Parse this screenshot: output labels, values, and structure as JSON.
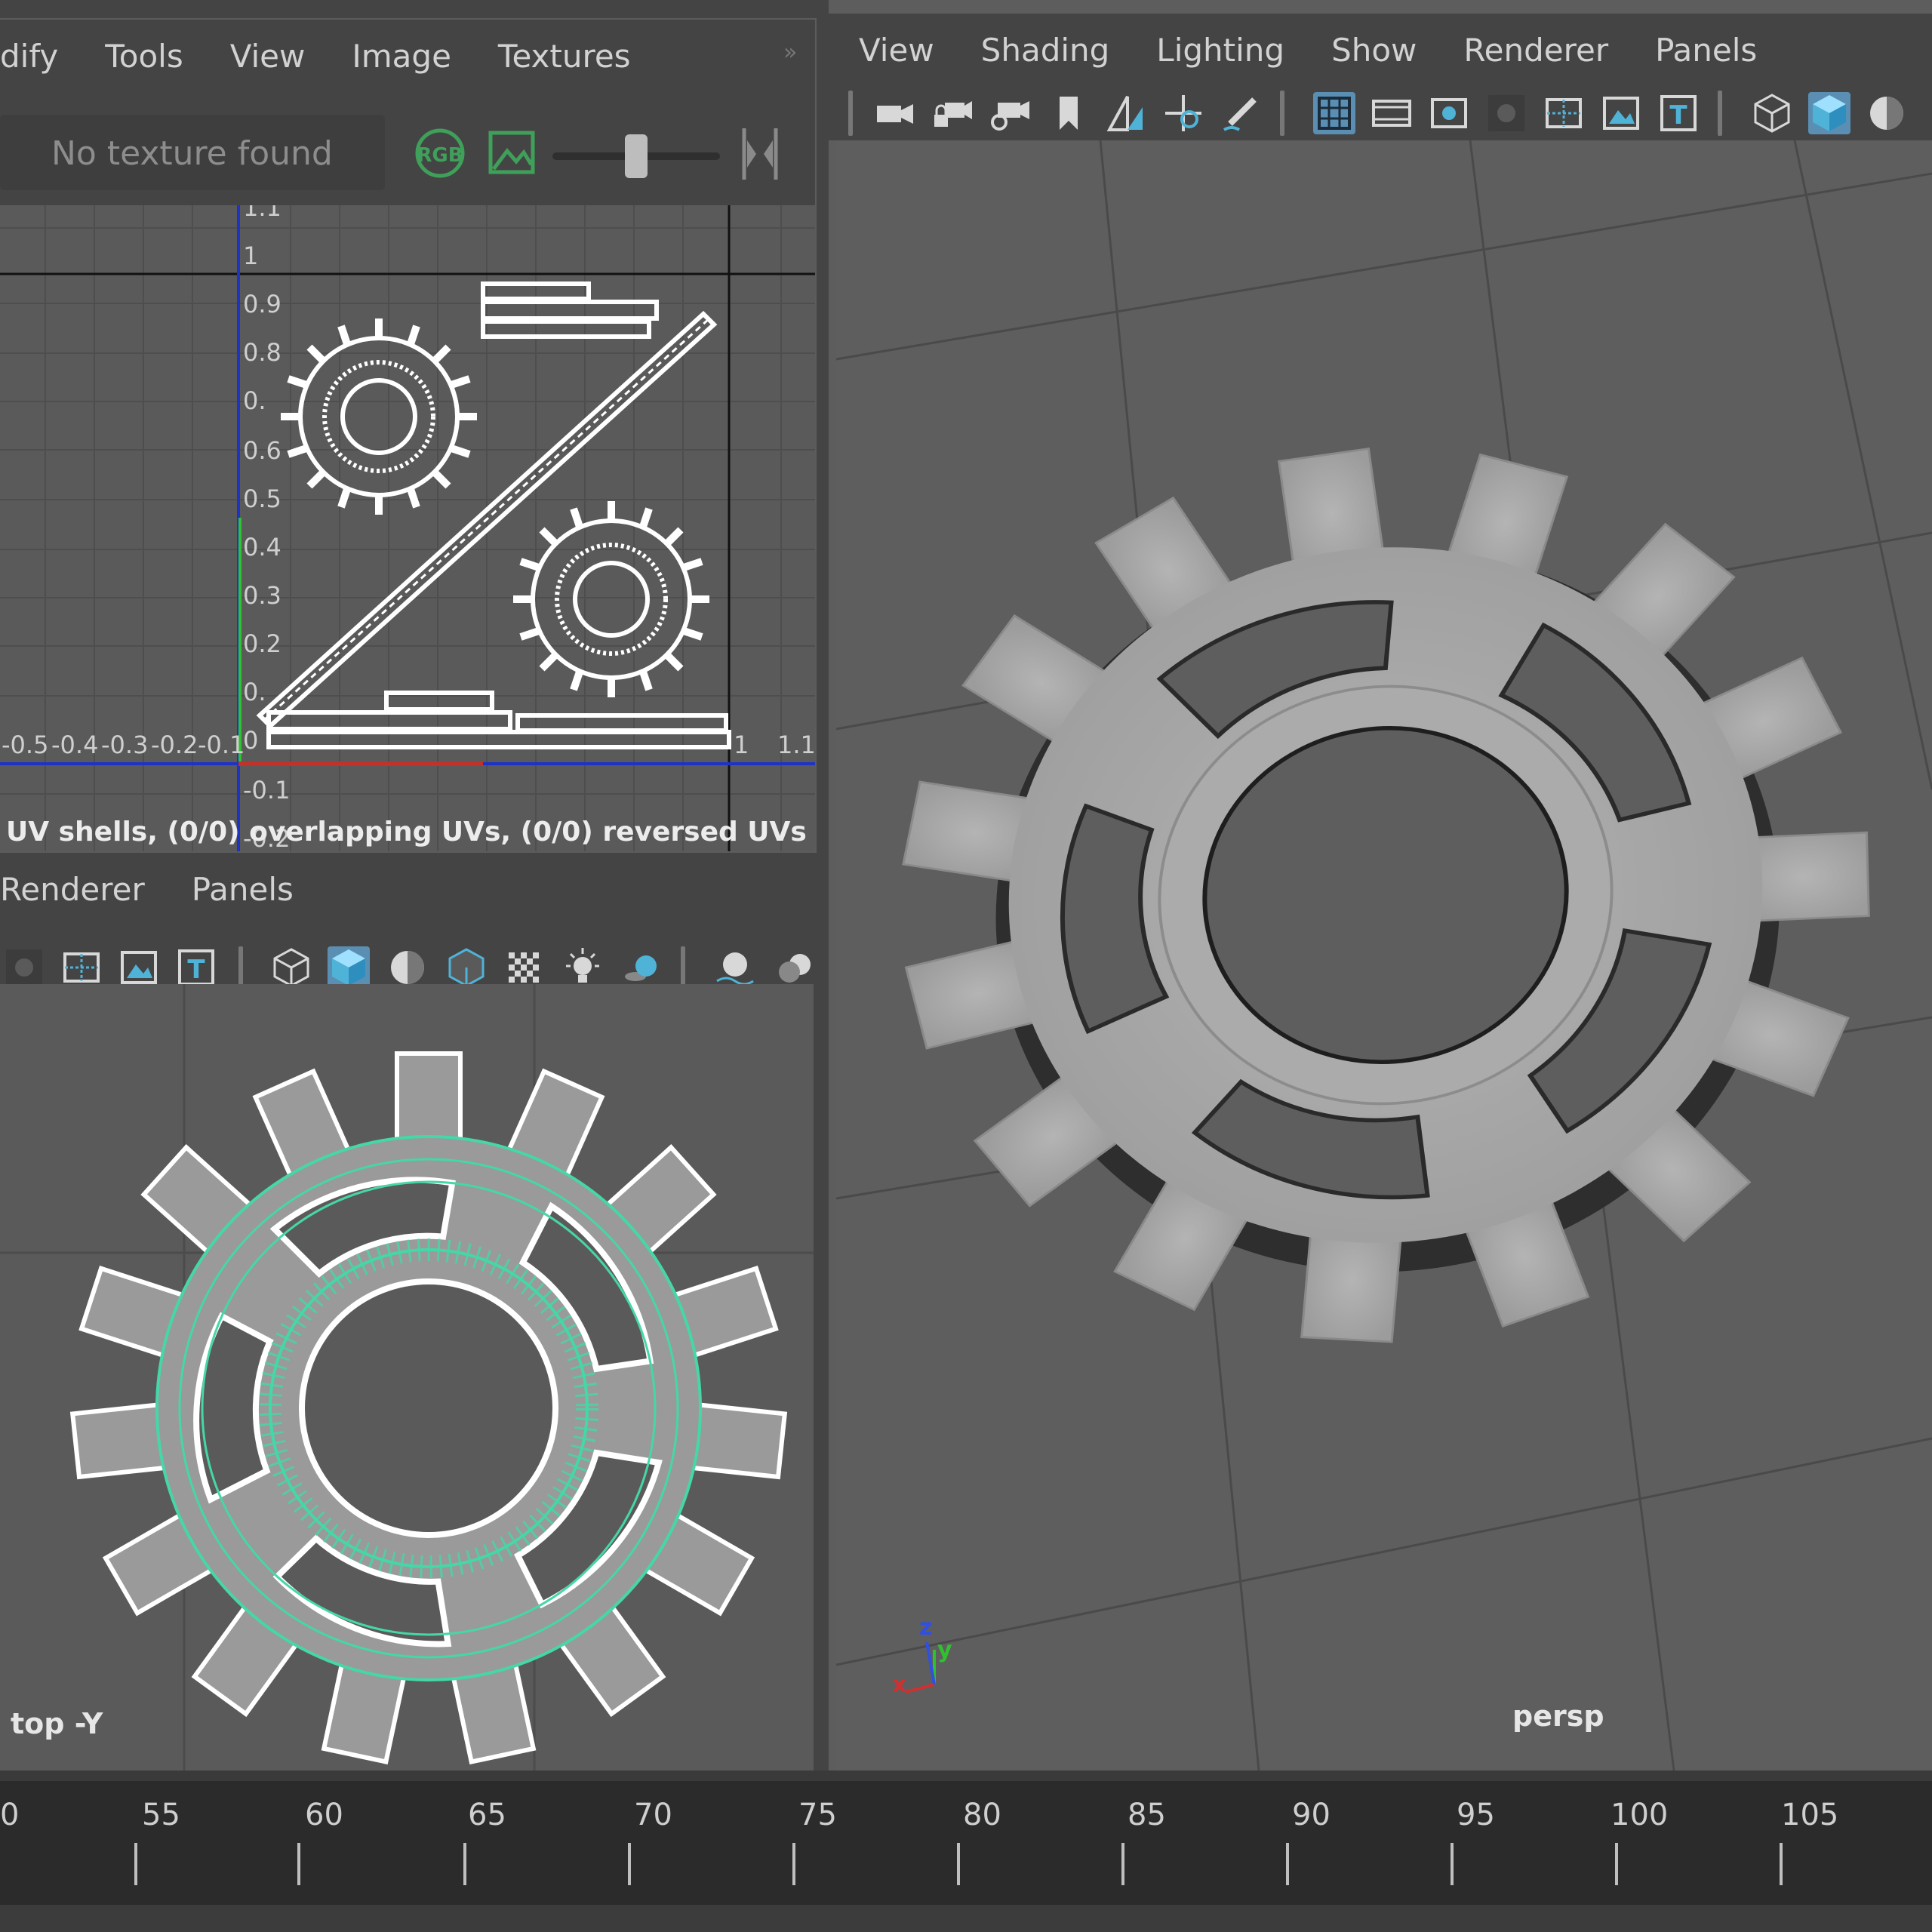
{
  "uv_editor": {
    "menu": [
      "dify",
      "Tools",
      "View",
      "Image",
      "Textures"
    ],
    "texture_field": "No texture found",
    "rgb_label": "RGB",
    "status": "UV shells, (0/0) overlapping UVs, (0/0) reversed UVs",
    "axis_ticks_v": [
      "1.1",
      "1",
      "0.9",
      "0.8",
      "0.",
      "0.6",
      "0.5",
      "0.4",
      "0.3",
      "0.2",
      "0.",
      "0",
      "-0.1",
      "-0.2"
    ],
    "axis_ticks_u": [
      "-0.5",
      "-0.4",
      "-0.3",
      "-0.2",
      "-0.1",
      "1",
      "1.1"
    ]
  },
  "persp_panel": {
    "menu": [
      "View",
      "Shading",
      "Lighting",
      "Show",
      "Renderer",
      "Panels"
    ],
    "camera_label": "persp",
    "axis_letters": {
      "x": "x",
      "y": "y",
      "z": "z"
    }
  },
  "top_panel": {
    "menu": [
      "Renderer",
      "Panels"
    ],
    "camera_label": "top -Y"
  },
  "timeline": {
    "frames": [
      "0",
      "55",
      "60",
      "65",
      "70",
      "75",
      "80",
      "85",
      "90",
      "95",
      "100",
      "105"
    ]
  },
  "colors": {
    "accent_blue": "#5a8fb3",
    "wire_green": "#45d7a8",
    "gear_grey": "#a9a9a9",
    "axis_u": "#c0322a",
    "axis_v": "#1e32c8",
    "axis_green": "#30c030"
  },
  "icons": {
    "uv_toolbar": [
      "dropdown-arrow-icon",
      "rgb-channels-icon",
      "image-display-icon",
      "exposure-slider-icon",
      "collapse-icon"
    ],
    "persp_toolbar": [
      "camera-icon",
      "lock-camera-icon",
      "camera-attributes-icon",
      "bookmark-icon",
      "image-plane-icon",
      "2d-pan-zoom-icon",
      "grease-pencil-icon",
      "grid-icon",
      "film-gate-icon",
      "resolution-gate-icon",
      "gate-mask-icon",
      "field-chart-icon",
      "safe-action-icon",
      "safe-title-icon",
      "wireframe-icon",
      "smooth-shade-icon",
      "default-material-icon"
    ],
    "top_toolbar": [
      "gate-mask-icon",
      "field-chart-icon",
      "safe-action-icon",
      "safe-title-icon",
      "wireframe-icon",
      "smooth-shade-icon",
      "default-material-icon",
      "wireframe-on-shaded-icon",
      "xray-icon",
      "lighting-icon",
      "shadows-icon",
      "screen-space-ao-icon",
      "motion-blur-icon"
    ]
  }
}
